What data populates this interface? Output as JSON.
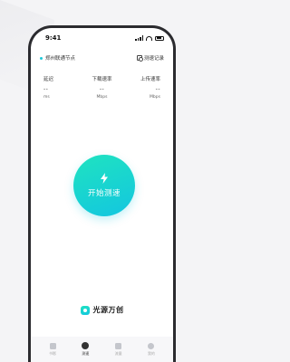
{
  "status_bar": {
    "time": "9:41"
  },
  "node": {
    "label": "郑州联通节点"
  },
  "records": {
    "label": "测速记录"
  },
  "metrics": [
    {
      "label": "延迟",
      "value": "--",
      "unit": "ms"
    },
    {
      "label": "下载速率",
      "value": "--",
      "unit": "Mbps"
    },
    {
      "label": "上传速率",
      "value": "--",
      "unit": "Mbps"
    }
  ],
  "start_button": {
    "label": "开始测速"
  },
  "brand": {
    "name": "光源万创"
  },
  "tabs": [
    {
      "label": "书影",
      "icon": "document-icon",
      "active": false
    },
    {
      "label": "测速",
      "icon": "speedometer-icon",
      "active": true
    },
    {
      "label": "流量",
      "icon": "box-icon",
      "active": false
    },
    {
      "label": "我的",
      "icon": "person-icon",
      "active": false
    }
  ],
  "colors": {
    "accent_start": "#1fe3c0",
    "accent_end": "#13c6e0"
  }
}
